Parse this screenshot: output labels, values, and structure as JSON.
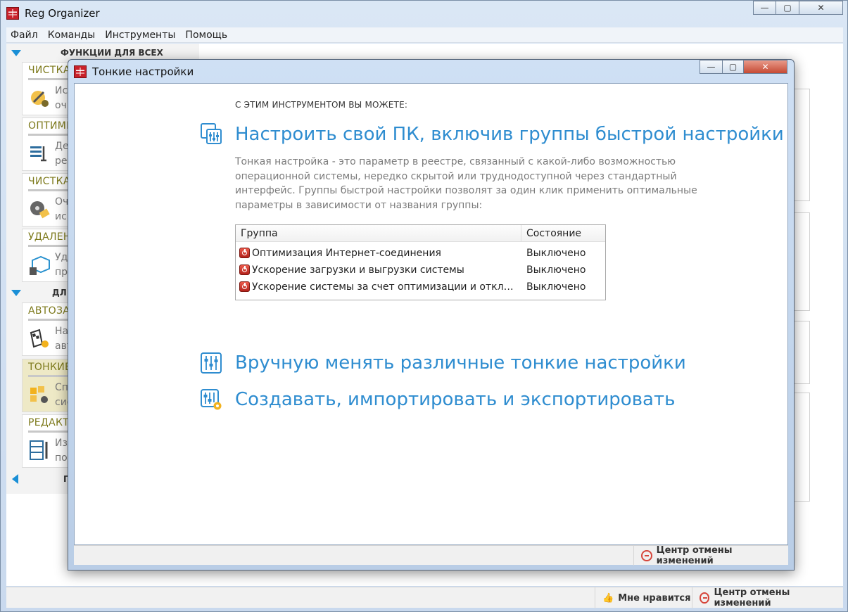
{
  "main_window": {
    "title": "Reg Organizer",
    "menu": [
      "Файл",
      "Команды",
      "Инструменты",
      "Помощь"
    ],
    "sidebar": {
      "section1_header": "ФУНКЦИИ ДЛЯ ВСЕХ",
      "section2_header": "ДЛ",
      "section3_header": "ПІ",
      "cards": [
        {
          "title": "ЧИСТКА",
          "line1": "Ис",
          "line2": "очи",
          "icon": "broom-icon",
          "active": false
        },
        {
          "title": "ОПТИМИ",
          "line1": "Де",
          "line2": "рее",
          "icon": "registry-defrag-icon",
          "active": false
        },
        {
          "title": "ЧИСТКА",
          "line1": "Оч",
          "line2": "исп",
          "icon": "disk-clean-icon",
          "active": false
        },
        {
          "title": "УДАЛЕН",
          "line1": "Уда",
          "line2": "пр",
          "icon": "uninstall-icon",
          "active": false
        },
        {
          "title": "АВТОЗА",
          "line1": "На",
          "line2": "авт",
          "icon": "autorun-icon",
          "active": false
        },
        {
          "title": "ТОНКИЕ",
          "line1": "Сп",
          "line2": "сис",
          "icon": "tweaks-icon",
          "active": true
        },
        {
          "title": "РЕДАКТ",
          "line1": "Из",
          "line2": "по",
          "icon": "registry-editor-icon",
          "active": false
        }
      ]
    },
    "status": {
      "like_label": "Мне нравится",
      "undo_center_label": "Центр отмены изменений"
    }
  },
  "dialog": {
    "title": "Тонкие настройки",
    "caption": "С ЭТИМ ИНСТРУМЕНТОМ ВЫ МОЖЕТЕ:",
    "feature1": {
      "heading": "Настроить свой ПК, включив группы быстрой настройки",
      "description": "Тонкая настройка - это параметр в реестре, связанный с какой-либо возможностью операционной системы, нередко скрытой или труднодоступной через стандартный интерфейс. Группы быстрой настройки позволят за один клик применить оптимальные параметры в зависимости от названия группы:"
    },
    "table": {
      "col_group": "Группа",
      "col_state": "Состояние",
      "rows": [
        {
          "name": "Оптимизация Интернет-соединения",
          "state": "Выключено"
        },
        {
          "name": "Ускорение загрузки и выгрузки системы",
          "state": "Выключено"
        },
        {
          "name": "Ускорение системы за счет оптимизации и отключе…",
          "state": "Выключено"
        }
      ]
    },
    "feature2": {
      "heading": "Вручную менять различные тонкие настройки"
    },
    "feature3": {
      "heading": "Создавать, импортировать и экспортировать"
    },
    "status": {
      "undo_center_label": "Центр отмены изменений"
    }
  },
  "colors": {
    "accent_blue": "#2f8dd0",
    "sidebar_title": "#7d7a1c",
    "active_card": "#eee9c6",
    "off_red": "#c0281f"
  }
}
